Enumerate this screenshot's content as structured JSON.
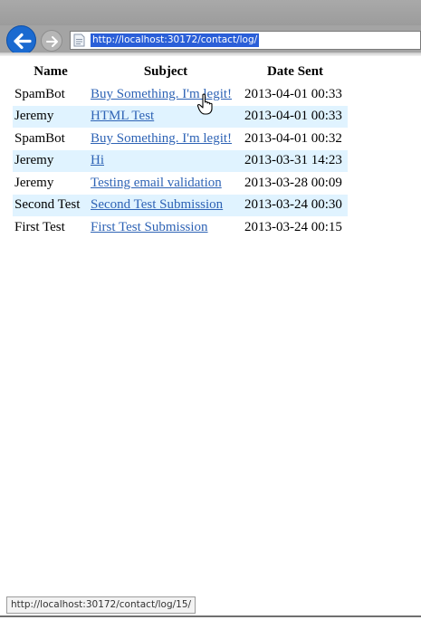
{
  "browser": {
    "address_url": "http://localhost:30172/contact/log/",
    "status_url": "http://localhost:30172/contact/log/15/",
    "back_icon": "back-arrow-icon",
    "forward_icon": "forward-arrow-icon",
    "page_icon": "page-icon"
  },
  "table": {
    "headers": [
      "Name",
      "Subject",
      "Date Sent"
    ],
    "rows": [
      {
        "name": "SpamBot",
        "subject": "Buy Something. I'm legit!",
        "date": "2013-04-01 00:33"
      },
      {
        "name": "Jeremy",
        "subject": "HTML Test",
        "date": "2013-04-01 00:33"
      },
      {
        "name": "SpamBot",
        "subject": "Buy Something. I'm legit!",
        "date": "2013-04-01 00:32"
      },
      {
        "name": "Jeremy",
        "subject": "Hi",
        "date": "2013-03-31 14:23"
      },
      {
        "name": "Jeremy",
        "subject": "Testing email validation",
        "date": "2013-03-28 00:09"
      },
      {
        "name": "Second Test",
        "subject": "Second Test Submission",
        "date": "2013-03-24 00:30"
      },
      {
        "name": "First Test",
        "subject": "First Test Submission",
        "date": "2013-03-24 00:15"
      }
    ]
  },
  "colors": {
    "link": "#2e63b5",
    "alt_row": "#e0f3ff",
    "back_button": "#1b6ad0",
    "url_highlight": "#2b5fd8"
  }
}
